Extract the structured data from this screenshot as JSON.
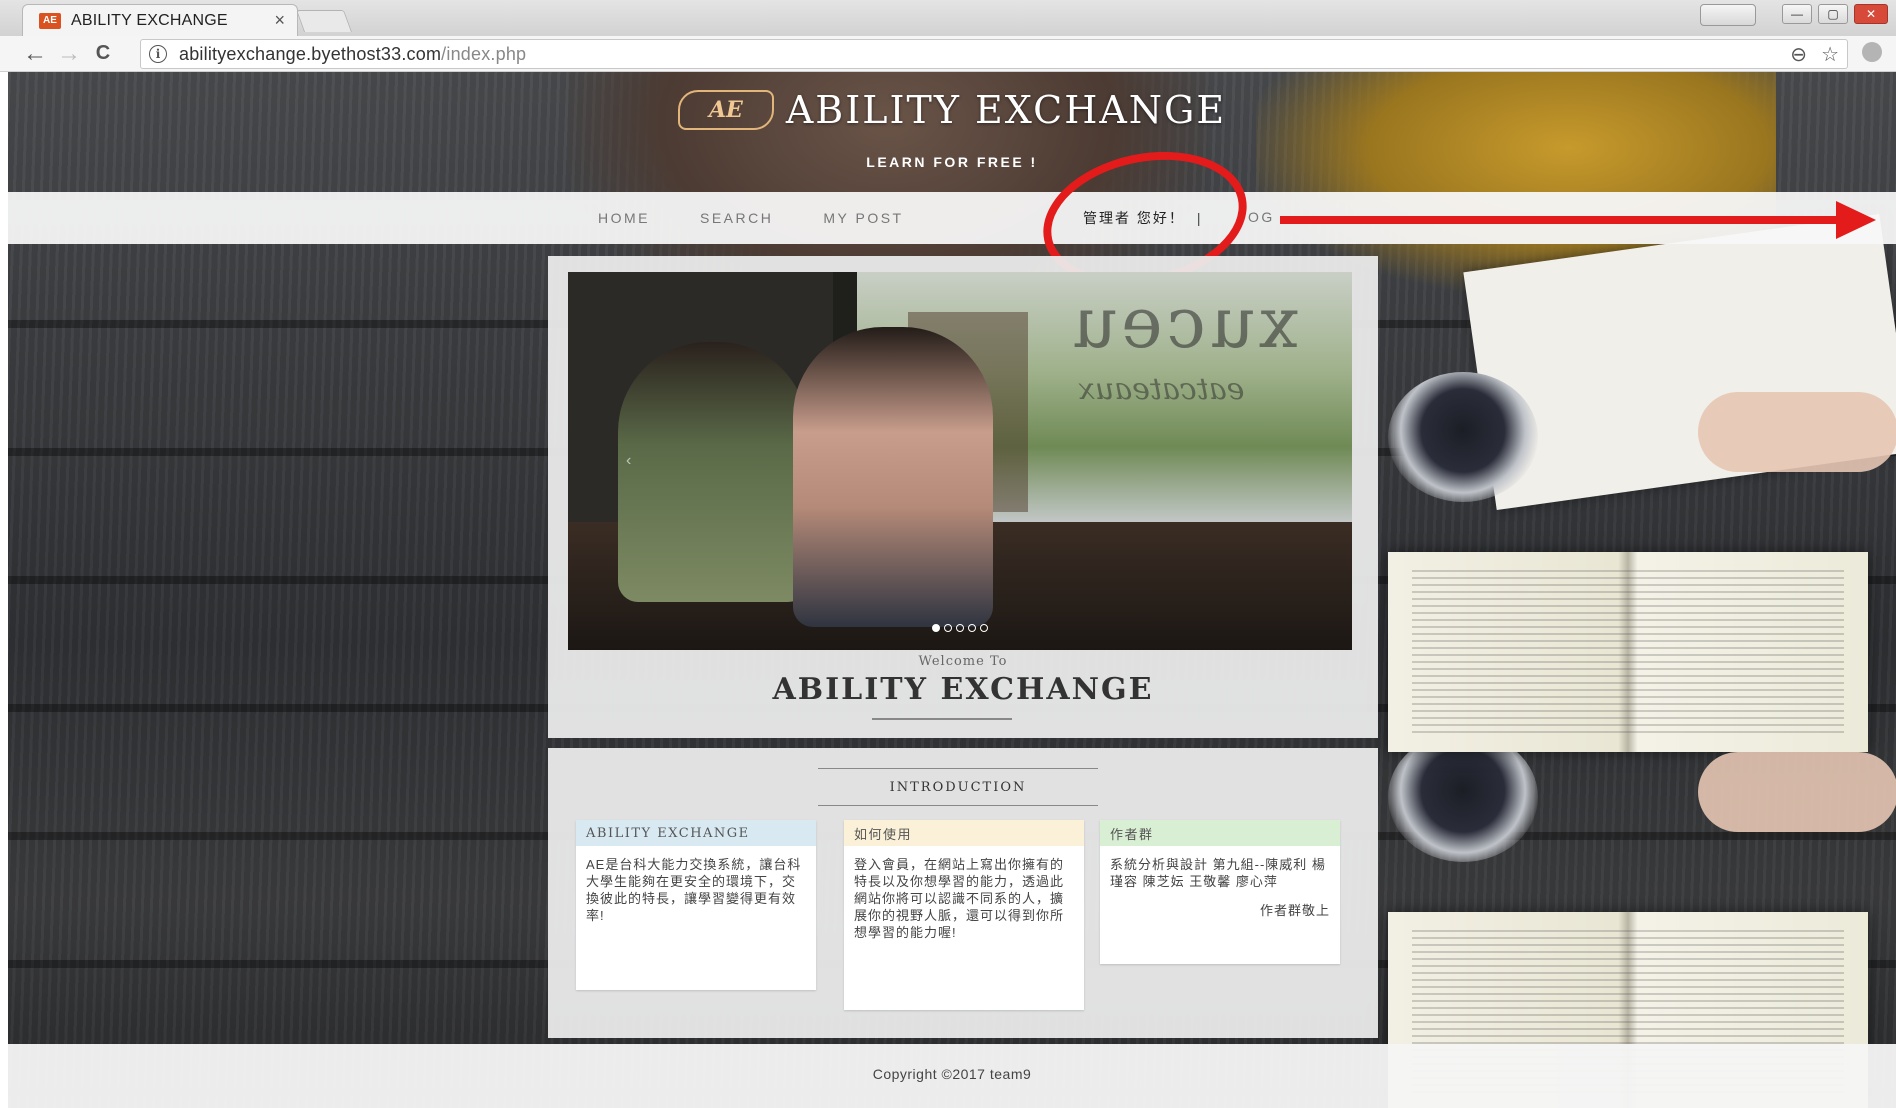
{
  "browser": {
    "tab_title": "ABILITY EXCHANGE",
    "favicon_text": "AE",
    "tab_close": "×",
    "url_host": "abilityexchange.byethost33.com",
    "url_path": "/index.php",
    "icons": {
      "back": "←",
      "forward": "→",
      "reload": "C",
      "info": "i",
      "zoom": "⊖",
      "star": "☆"
    }
  },
  "site": {
    "logo_text": "AE",
    "title": "ABILITY EXCHANGE",
    "tagline": "LEARN FOR FREE !"
  },
  "nav": {
    "items": [
      {
        "label": "HOME"
      },
      {
        "label": "SEARCH"
      },
      {
        "label": "MY POST"
      }
    ],
    "greeting": "管理者 您好！",
    "separator": "|",
    "log_label": "OG"
  },
  "slider": {
    "slide_count": 5,
    "active_index": 0
  },
  "hero": {
    "welcome": "Welcome To",
    "title": "ABILITY EXCHANGE"
  },
  "intro": {
    "heading": "INTRODUCTION",
    "columns": [
      {
        "heading": "ABILITY EXCHANGE",
        "body": "AE是台科大能力交換系統，讓台科大學生能夠在更安全的環境下，交換彼此的特長，讓學習變得更有效率!"
      },
      {
        "heading": "如何使用",
        "body": "登入會員，在網站上寫出你擁有的特長以及你想學習的能力，透過此網站你將可以認識不同系的人，擴展你的視野人脈，還可以得到你所想學習的能力喔!"
      },
      {
        "heading": "作者群",
        "body": "系統分析與設計 第九組--陳威利 楊瑾容 陳芝妘 王敬馨 廖心萍",
        "sign": "作者群敬上"
      }
    ]
  },
  "footer": {
    "copyright": "Copyright ©2017 team9"
  },
  "colors": {
    "annotation_red": "#e31b1b",
    "col1_header": "#d8e9f2",
    "col2_header": "#fbf1d8",
    "col3_header": "#d9efd4"
  }
}
